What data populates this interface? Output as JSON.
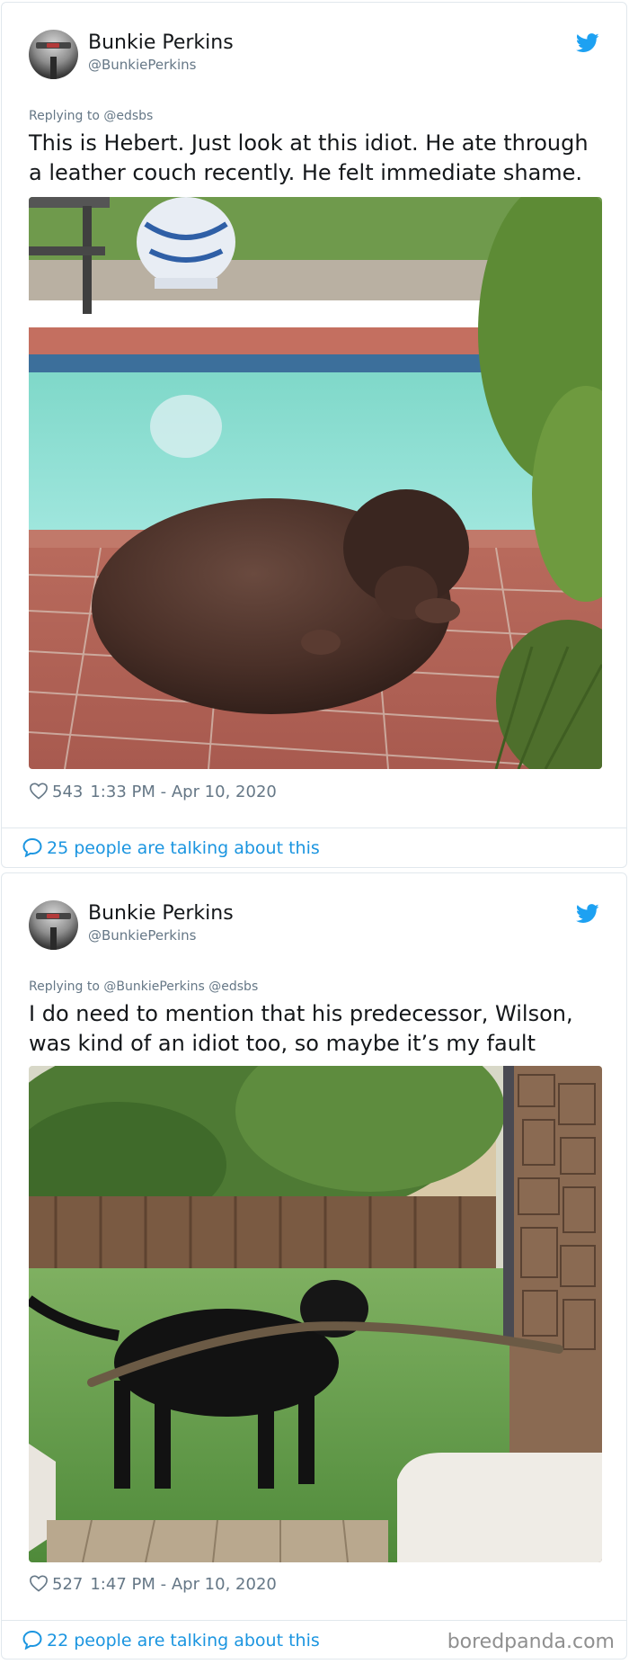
{
  "tweets": [
    {
      "author_name": "Bunkie Perkins",
      "author_handle": "@BunkiePerkins",
      "replying_to": "Replying to @edsbs",
      "text": "This is Hebert. Just look at this idiot. He ate through a leather couch recently. He felt immediate shame.",
      "likes": "543",
      "timestamp": "1:33 PM - Apr 10, 2020",
      "talking": "25 people are talking about this"
    },
    {
      "author_name": "Bunkie Perkins",
      "author_handle": "@BunkiePerkins",
      "replying_to": "Replying to @BunkiePerkins @edsbs",
      "text": "I do need to mention that his predecessor, Wilson, was kind of an idiot too, so maybe it’s my fault",
      "likes": "527",
      "timestamp": "1:47 PM - Apr 10, 2020",
      "talking": "22 people are talking about this"
    }
  ],
  "icons": {
    "brand": "twitter-bird-icon",
    "like": "heart-icon",
    "reply": "speech-bubble-icon"
  },
  "colors": {
    "twitter_blue": "#1da1f2",
    "link_blue": "#1b95e0",
    "muted_text": "#657786",
    "border": "#e1e8ed"
  },
  "watermark": "boredpanda.com"
}
